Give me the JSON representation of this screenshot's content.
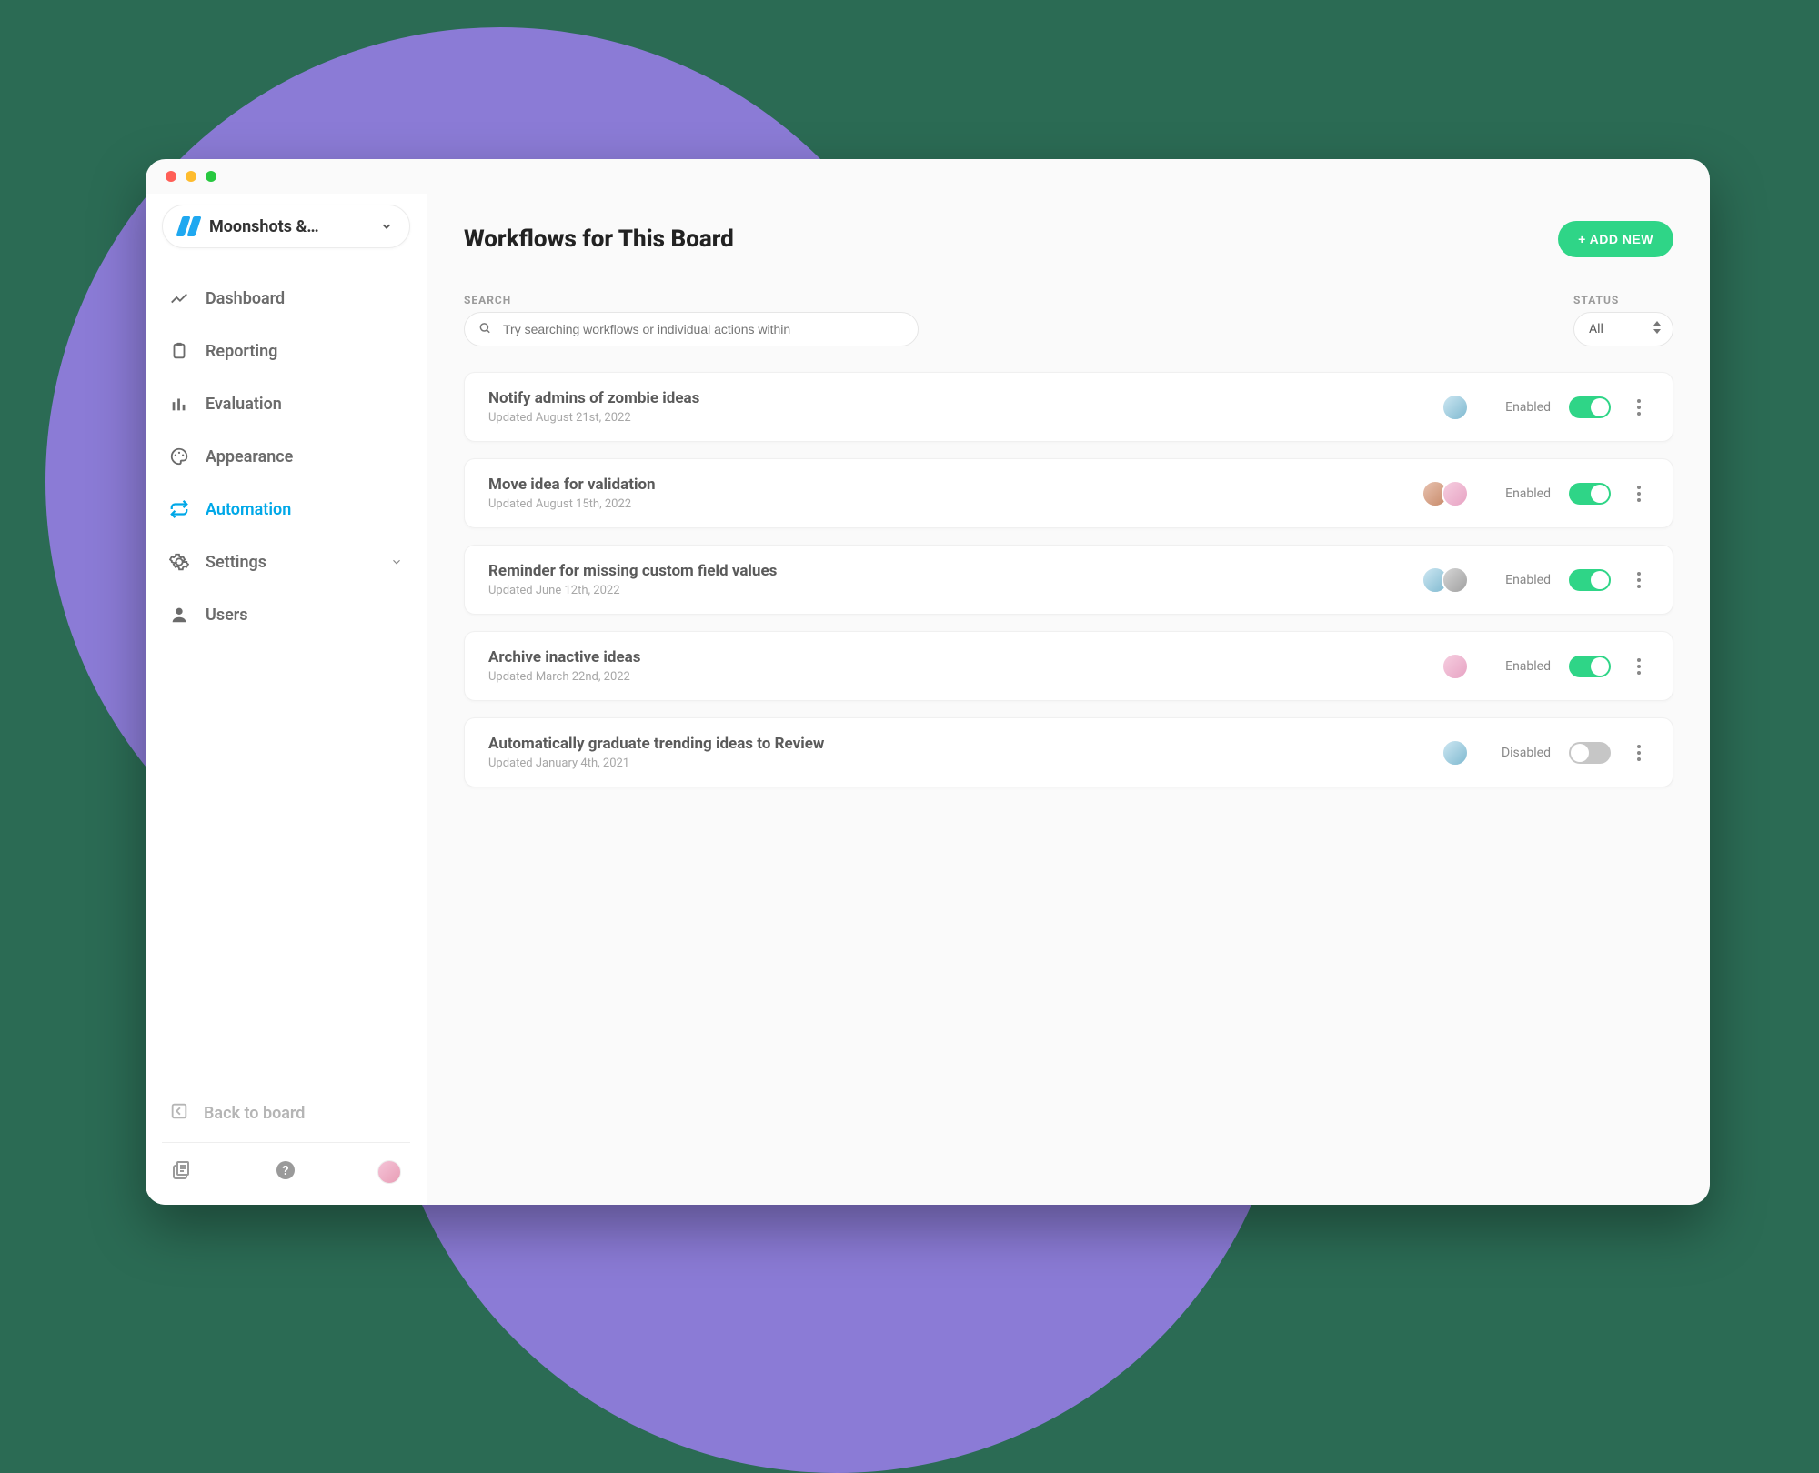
{
  "sidebar": {
    "board_name": "Moonshots &…",
    "items": [
      {
        "label": "Dashboard",
        "icon": "chart-line-icon"
      },
      {
        "label": "Reporting",
        "icon": "clipboard-icon"
      },
      {
        "label": "Evaluation",
        "icon": "bars-icon"
      },
      {
        "label": "Appearance",
        "icon": "palette-icon"
      },
      {
        "label": "Automation",
        "icon": "sync-icon"
      },
      {
        "label": "Settings",
        "icon": "gear-icon"
      },
      {
        "label": "Users",
        "icon": "user-icon"
      }
    ],
    "active_index": 4,
    "settings_expandable": true,
    "back_label": "Back to board"
  },
  "header": {
    "title": "Workflows for This Board",
    "add_button": "+ ADD NEW"
  },
  "filters": {
    "search_label": "SEARCH",
    "search_placeholder": "Try searching workflows or individual actions within",
    "status_label": "STATUS",
    "status_value": "All"
  },
  "workflows": [
    {
      "title": "Notify admins of zombie ideas",
      "updated": "Updated August 21st, 2022",
      "avatars": [
        "c1"
      ],
      "status": "Enabled",
      "enabled": true
    },
    {
      "title": "Move idea for validation",
      "updated": "Updated August 15th, 2022",
      "avatars": [
        "c2",
        "c3"
      ],
      "status": "Enabled",
      "enabled": true
    },
    {
      "title": "Reminder for missing custom field values",
      "updated": "Updated June 12th, 2022",
      "avatars": [
        "c1",
        "c4"
      ],
      "status": "Enabled",
      "enabled": true
    },
    {
      "title": "Archive inactive ideas",
      "updated": "Updated March 22nd, 2022",
      "avatars": [
        "c3"
      ],
      "status": "Enabled",
      "enabled": true
    },
    {
      "title": "Automatically graduate trending ideas to Review",
      "updated": "Updated January 4th, 2021",
      "avatars": [
        "c1"
      ],
      "status": "Disabled",
      "enabled": false
    }
  ]
}
